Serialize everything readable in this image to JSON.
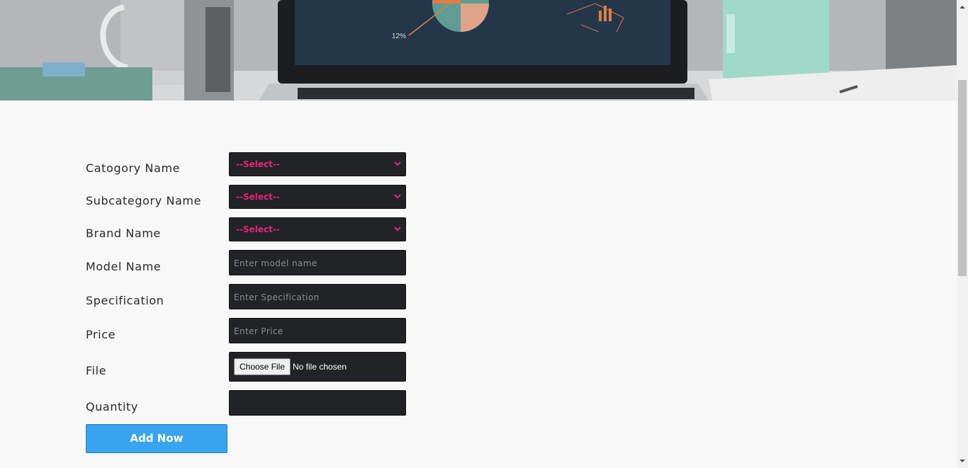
{
  "banner": {
    "chart_label": "12%"
  },
  "form": {
    "fields": [
      {
        "label": "Catogory Name",
        "type": "select",
        "value": "--Select--"
      },
      {
        "label": "Subcategory Name",
        "type": "select",
        "value": "--Select--"
      },
      {
        "label": "Brand Name",
        "type": "select",
        "value": "--Select--"
      },
      {
        "label": "Model Name",
        "type": "input",
        "placeholder": "Enter model name"
      },
      {
        "label": "Specification",
        "type": "input",
        "placeholder": "Enter Specification"
      },
      {
        "label": "Price",
        "type": "input",
        "placeholder": "Enter Price"
      },
      {
        "label": "File",
        "type": "file",
        "button": "Choose File",
        "status": "No file chosen"
      },
      {
        "label": "Quantity",
        "type": "input",
        "placeholder": ""
      }
    ],
    "submit_label": "Add Now"
  },
  "colors": {
    "accent": "#39a4ef",
    "select_text": "#e5247a",
    "field_bg": "#222327"
  }
}
